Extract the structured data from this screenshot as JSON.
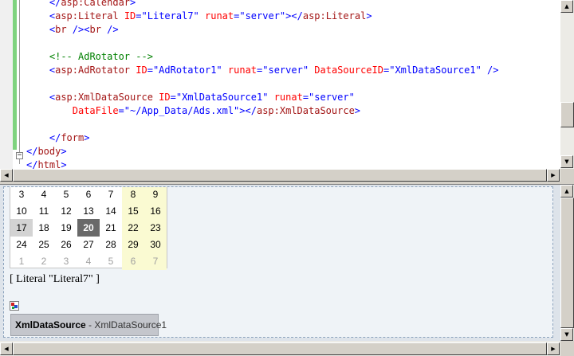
{
  "code": {
    "lines": [
      {
        "indent": 4,
        "tokens": [
          [
            "tag",
            "</"
          ],
          [
            "el",
            "asp:Calendar"
          ],
          [
            "tag",
            ">"
          ]
        ]
      },
      {
        "indent": 4,
        "tokens": [
          [
            "tag",
            "<"
          ],
          [
            "el",
            "asp:Literal"
          ],
          [
            "txt",
            " "
          ],
          [
            "attr",
            "ID"
          ],
          [
            "tag",
            "="
          ],
          [
            "val",
            "\"Literal7\""
          ],
          [
            "txt",
            " "
          ],
          [
            "attr",
            "runat"
          ],
          [
            "tag",
            "="
          ],
          [
            "val",
            "\"server\""
          ],
          [
            "tag",
            "></"
          ],
          [
            "el",
            "asp:Literal"
          ],
          [
            "tag",
            ">"
          ]
        ]
      },
      {
        "indent": 4,
        "tokens": [
          [
            "tag",
            "<"
          ],
          [
            "el",
            "br"
          ],
          [
            "txt",
            " "
          ],
          [
            "tag",
            "/><"
          ],
          [
            "el",
            "br"
          ],
          [
            "txt",
            " "
          ],
          [
            "tag",
            "/>"
          ]
        ]
      },
      {
        "indent": 0,
        "tokens": []
      },
      {
        "indent": 4,
        "tokens": [
          [
            "com",
            "<!-- AdRotator -->"
          ]
        ]
      },
      {
        "indent": 4,
        "tokens": [
          [
            "tag",
            "<"
          ],
          [
            "el",
            "asp:AdRotator"
          ],
          [
            "txt",
            " "
          ],
          [
            "attr",
            "ID"
          ],
          [
            "tag",
            "="
          ],
          [
            "val",
            "\"AdRotator1\""
          ],
          [
            "txt",
            " "
          ],
          [
            "attr",
            "runat"
          ],
          [
            "tag",
            "="
          ],
          [
            "val",
            "\"server\""
          ],
          [
            "txt",
            " "
          ],
          [
            "attr",
            "DataSourceID"
          ],
          [
            "tag",
            "="
          ],
          [
            "val",
            "\"XmlDataSource1\""
          ],
          [
            "txt",
            " "
          ],
          [
            "tag",
            "/>"
          ]
        ]
      },
      {
        "indent": 0,
        "tokens": []
      },
      {
        "indent": 4,
        "tokens": [
          [
            "tag",
            "<"
          ],
          [
            "el",
            "asp:XmlDataSource"
          ],
          [
            "txt",
            " "
          ],
          [
            "attr",
            "ID"
          ],
          [
            "tag",
            "="
          ],
          [
            "val",
            "\"XmlDataSource1\""
          ],
          [
            "txt",
            " "
          ],
          [
            "attr",
            "runat"
          ],
          [
            "tag",
            "="
          ],
          [
            "val",
            "\"server\""
          ]
        ]
      },
      {
        "indent": 8,
        "tokens": [
          [
            "attr",
            "DataFile"
          ],
          [
            "tag",
            "="
          ],
          [
            "val",
            "\"~/App_Data/Ads.xml\""
          ],
          [
            "tag",
            "></"
          ],
          [
            "el",
            "asp:XmlDataSource"
          ],
          [
            "tag",
            ">"
          ]
        ]
      },
      {
        "indent": 0,
        "tokens": []
      },
      {
        "indent": 4,
        "tokens": [
          [
            "tag",
            "</"
          ],
          [
            "el",
            "form"
          ],
          [
            "tag",
            ">"
          ]
        ]
      },
      {
        "indent": 0,
        "tokens": [
          [
            "tag",
            "</"
          ],
          [
            "el",
            "body"
          ],
          [
            "tag",
            ">"
          ]
        ]
      },
      {
        "indent": 0,
        "tokens": [
          [
            "tag",
            "</"
          ],
          [
            "el",
            "html"
          ],
          [
            "tag",
            ">"
          ]
        ]
      }
    ]
  },
  "calendar": {
    "weeks": [
      [
        "3",
        "4",
        "5",
        "6",
        "7",
        "8",
        "9"
      ],
      [
        "10",
        "11",
        "12",
        "13",
        "14",
        "15",
        "16"
      ],
      [
        "17",
        "18",
        "19",
        "20",
        "21",
        "22",
        "23"
      ],
      [
        "24",
        "25",
        "26",
        "27",
        "28",
        "29",
        "30"
      ],
      [
        "1",
        "2",
        "3",
        "4",
        "5",
        "6",
        "7"
      ]
    ],
    "today": "17",
    "selected": "20"
  },
  "design": {
    "literal_text": "[ Literal \"Literal7\" ]",
    "xmlds_type": "XmlDataSource",
    "xmlds_id": " - XmlDataSource1"
  },
  "icons": {
    "adrotator": "adrotator-icon",
    "scroll_up": "arrow-up-icon",
    "scroll_down": "arrow-down-icon",
    "scroll_left": "arrow-left-icon",
    "scroll_right": "arrow-right-icon"
  },
  "colors": {
    "tag": "#0000ff",
    "element": "#a31515",
    "attribute": "#ff0000",
    "comment": "#008000",
    "weekend_bg": "#fafad2",
    "selected_bg": "#696969",
    "today_bg": "#d3d3d3",
    "design_bg": "#eff3f7"
  }
}
